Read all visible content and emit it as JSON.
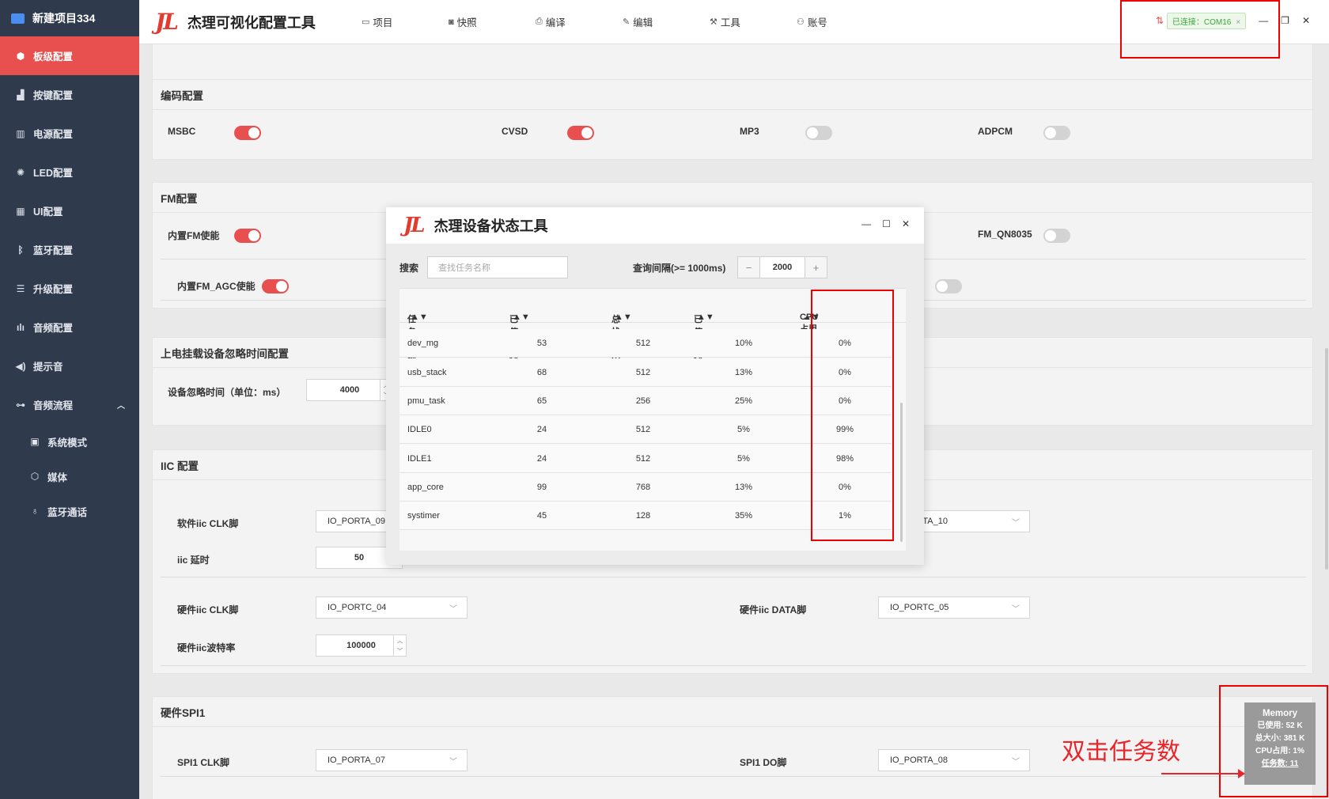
{
  "sidebar": {
    "project": "新建项目334",
    "items": [
      {
        "label": "板级配置",
        "icon": "cube-icon"
      },
      {
        "label": "按键配置",
        "icon": "keys-icon"
      },
      {
        "label": "电源配置",
        "icon": "power-icon"
      },
      {
        "label": "LED配置",
        "icon": "light-icon"
      },
      {
        "label": "UI配置",
        "icon": "grid-icon"
      },
      {
        "label": "蓝牙配置",
        "icon": "bluetooth-icon"
      },
      {
        "label": "升级配置",
        "icon": "list-icon"
      },
      {
        "label": "音频配置",
        "icon": "waveform-icon"
      },
      {
        "label": "提示音",
        "icon": "speaker-icon"
      },
      {
        "label": "音频流程",
        "icon": "flow-icon"
      }
    ],
    "subitems": [
      {
        "label": "系统模式",
        "icon": "screen-icon"
      },
      {
        "label": "媒体",
        "icon": "box-icon"
      },
      {
        "label": "蓝牙通话",
        "icon": "mic-icon"
      }
    ]
  },
  "topbar": {
    "logo": "JL",
    "title": "杰理可视化配置工具",
    "menu": [
      {
        "label": "项目",
        "icon": "folder-icon"
      },
      {
        "label": "快照",
        "icon": "camera-icon"
      },
      {
        "label": "编译",
        "icon": "printer-icon"
      },
      {
        "label": "编辑",
        "icon": "pencil-icon"
      },
      {
        "label": "工具",
        "icon": "wrench-icon"
      },
      {
        "label": "账号",
        "icon": "user-icon"
      }
    ],
    "connection": "已连接：COM16",
    "close_tag": "×"
  },
  "encode": {
    "title": "编码配置",
    "items": [
      {
        "label": "MSBC",
        "on": true
      },
      {
        "label": "CVSD",
        "on": true
      },
      {
        "label": "MP3",
        "on": false
      },
      {
        "label": "ADPCM",
        "on": false
      }
    ]
  },
  "fm": {
    "title": "FM配置",
    "enable_label": "内置FM使能",
    "agc_label": "内置FM_AGC使能",
    "qn8035_label": "FM_QN8035"
  },
  "power_ignore": {
    "title": "上电挂载设备忽略时间配置",
    "label": "设备忽略时间（单位：ms）",
    "value": "4000"
  },
  "iic": {
    "title": "IIC 配置",
    "soft_clk_label": "软件iic CLK脚",
    "soft_clk_value": "IO_PORTA_09",
    "soft_data_value": "IO_PORTA_10",
    "delay_label": "iic 延时",
    "delay_value": "50",
    "hw_clk_label": "硬件iic CLK脚",
    "hw_clk_value": "IO_PORTC_04",
    "hw_data_label": "硬件iic DATA脚",
    "hw_data_value": "IO_PORTC_05",
    "baud_label": "硬件iic波特率",
    "baud_value": "100000"
  },
  "spi": {
    "title": "硬件SPI1",
    "clk_label": "SPI1 CLK脚",
    "clk_value": "IO_PORTA_07",
    "do_label": "SPI1 DO脚",
    "do_value": "IO_PORTA_08"
  },
  "dialog": {
    "logo": "JL",
    "title": "杰理设备状态工具",
    "search_label": "搜索",
    "search_placeholder": "查找任务名称",
    "interval_label": "查询间隔(>= 1000ms)",
    "interval_value": "2000",
    "minus": "−",
    "plus": "+",
    "columns": [
      "任务名称",
      "已使用栈大小",
      "总栈大小",
      "已使用栈百分比",
      "CPU占用"
    ],
    "rows": [
      [
        "dev_mg",
        "53",
        "512",
        "10%",
        "0%"
      ],
      [
        "usb_stack",
        "68",
        "512",
        "13%",
        "0%"
      ],
      [
        "pmu_task",
        "65",
        "256",
        "25%",
        "0%"
      ],
      [
        "IDLE0",
        "24",
        "512",
        "5%",
        "99%"
      ],
      [
        "IDLE1",
        "24",
        "512",
        "5%",
        "98%"
      ],
      [
        "app_core",
        "99",
        "768",
        "13%",
        "0%"
      ],
      [
        "systimer",
        "45",
        "128",
        "35%",
        "1%"
      ]
    ]
  },
  "memory_widget": {
    "title": "Memory",
    "used": "已使用: 52 K",
    "total": "总大小: 381 K",
    "cpu": "CPU占用: 1%",
    "tasks": "任务数: 11"
  },
  "annotation": {
    "note": "双击任务数",
    "color": "#e8252a"
  },
  "colors": {
    "accent": "#e8504f",
    "sidebar_bg": "#2f3a4d"
  }
}
